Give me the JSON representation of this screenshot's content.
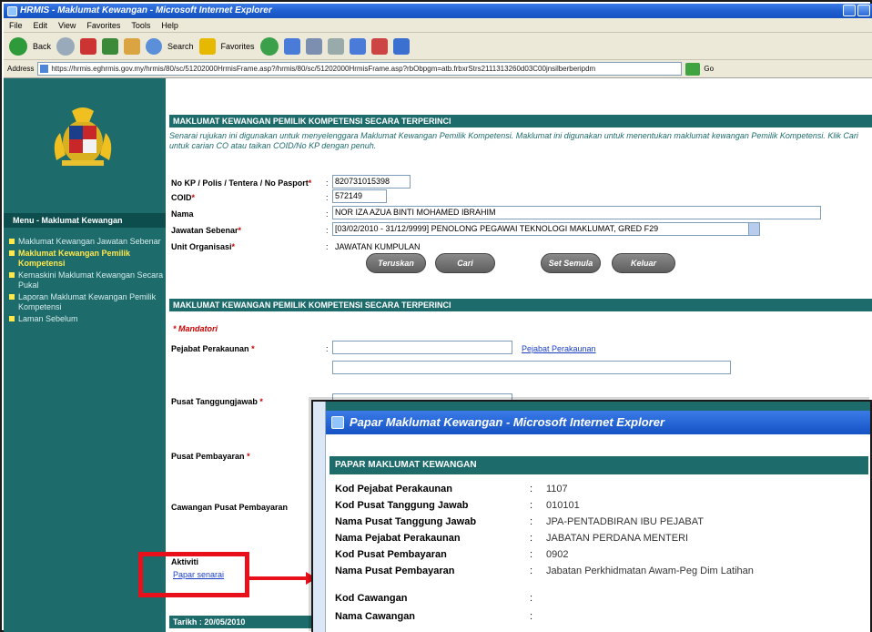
{
  "window": {
    "title": "HRMIS - Maklumat Kewangan - Microsoft Internet Explorer"
  },
  "menubar": [
    "File",
    "Edit",
    "View",
    "Favorites",
    "Tools",
    "Help"
  ],
  "toolbar": {
    "back": "Back",
    "search": "Search",
    "favorites": "Favorites"
  },
  "address": {
    "label": "Address",
    "url": "https://hrmis.eghrmis.gov.my/hrmis/80/sc/51202000HrmisFrame.asp?/hrmis/80/sc/51202000HrmisFrame.asp?rbObpgm=atb.frbxrStrs2111313260d03C00jnsilberberipdm",
    "go": "Go"
  },
  "sidebar": {
    "menu_title": "Menu - Maklumat Kewangan",
    "items": [
      {
        "label": "Maklumat Kewangan Jawatan Sebenar",
        "active": false
      },
      {
        "label": "Maklumat Kewangan Pemilik Kompetensi",
        "active": true
      },
      {
        "label": "Kemaskini Maklumat Kewangan Secara Pukal",
        "active": false
      },
      {
        "label": "Laporan Maklumat Kewangan Pemilik Kompetensi",
        "active": false
      },
      {
        "label": "Laman Sebelum",
        "active": false
      }
    ]
  },
  "main": {
    "section1_title": "MAKLUMAT KEWANGAN PEMILIK KOMPETENSI SECARA TERPERINCI",
    "intro": "Senarai rujukan ini digunakan untuk menyelenggara Maklumat Kewangan Pemilik Kompetensi. Maklumat ini digunakan untuk menentukan maklumat kewangan Pemilik Kompetensi. Klik Cari untuk carian CO atau taikan COID/No KP dengan penuh.",
    "fields": {
      "nokp_label": "No KP / Polis / Tentera / No Pasport",
      "nokp_value": "820731015398",
      "coid_label": "COID",
      "coid_value": "572149",
      "nama_label": "Nama",
      "nama_value": "NOR IZA AZUA BINTI MOHAMED IBRAHIM",
      "jawatan_label": "Jawatan Sebenar",
      "jawatan_value": "[03/02/2010 - 31/12/9999] PENOLONG PEGAWAI TEKNOLOGI MAKLUMAT, GRED F29",
      "unit_label": "Unit Organisasi",
      "unit_value": "JAWATAN KUMPULAN"
    },
    "buttons": [
      "Teruskan",
      "Cari",
      "Set Semula",
      "Keluar"
    ],
    "section2_title": "MAKLUMAT KEWANGAN PEMILIK KOMPETENSI SECARA TERPERINCI",
    "mandatori": "* Mandatori",
    "pejabat_label": "Pejabat Perakaunan",
    "pejabat_link": "Pejabat Perakaunan",
    "pusat_tj_label": "Pusat Tanggungjawab",
    "pusat_bayar_label": "Pusat Pembayaran",
    "cawangan_label": "Cawangan Pusat Pembayaran",
    "aktiviti_label": "Aktiviti",
    "papar_link": "Papar senarai",
    "tarikh": "Tarikh : 20/05/2010"
  },
  "popup": {
    "title": "Papar Maklumat Kewangan - Microsoft Internet Explorer",
    "header": "PAPAR MAKLUMAT KEWANGAN",
    "rows": [
      {
        "label": "Kod Pejabat Perakaunan",
        "value": "1107"
      },
      {
        "label": "Kod Pusat Tanggung Jawab",
        "value": "010101"
      },
      {
        "label": "Nama Pusat Tanggung Jawab",
        "value": "JPA-PENTADBIRAN IBU PEJABAT"
      },
      {
        "label": "Nama Pejabat Perakaunan",
        "value": "JABATAN PERDANA MENTERI"
      },
      {
        "label": "Kod Pusat Pembayaran",
        "value": "0902"
      },
      {
        "label": "Nama Pusat Pembayaran",
        "value": "Jabatan Perkhidmatan Awam-Peg Dim Latihan"
      },
      {
        "label": "Kod Cawangan",
        "value": ""
      },
      {
        "label": "Nama Cawangan",
        "value": ""
      }
    ]
  },
  "colors": {
    "teal": "#1d6b6b",
    "ie_blue": "#1552c4",
    "highlight_red": "#e8101a"
  }
}
